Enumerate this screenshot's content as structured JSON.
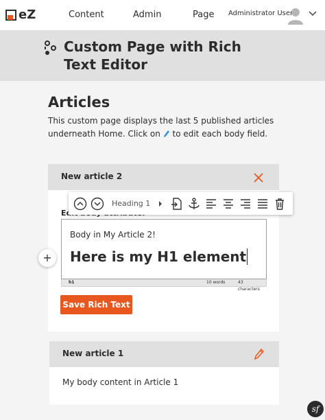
{
  "nav": {
    "logo_text": "eZ",
    "links": [
      "Content",
      "Admin",
      "Page"
    ],
    "user_name": "Administrator User"
  },
  "header": {
    "title": "Custom Page with Rich Text Editor"
  },
  "intro": {
    "heading": "Articles",
    "text_before": "This custom page displays the last 5 published articles underneath Home. Click on",
    "text_after": "to edit each body field."
  },
  "article_editing": {
    "title": "New article 2",
    "edit_label": "Edit body attribute:",
    "toolbar": {
      "style_label": "Heading 1"
    },
    "editor": {
      "paragraph": "Body in My Article 2!",
      "heading": "Here is my H1 element"
    },
    "status": {
      "path": "h1",
      "words": "10 words",
      "characters": "43 characters"
    },
    "save_label": "Save Rich Text"
  },
  "article_view": {
    "title": "New article 1",
    "body": "My body content in Article 1"
  },
  "colors": {
    "accent": "#e8571e",
    "header_bg": "#e0e0e0",
    "page_bg": "#f4f4f4"
  },
  "icons": {
    "move_up": "chevron-up-circle-icon",
    "move_down": "chevron-down-circle-icon",
    "embed": "embed-document-icon",
    "anchor": "anchor-icon",
    "align_left": "align-left-icon",
    "align_center": "align-center-icon",
    "align_right": "align-right-icon",
    "justify": "justify-icon",
    "delete": "trash-icon"
  }
}
